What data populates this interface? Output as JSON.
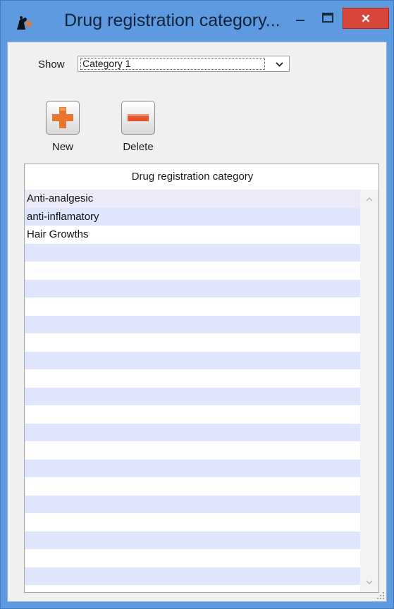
{
  "window": {
    "title": "Drug registration category..."
  },
  "filter": {
    "show_label": "Show",
    "selected": "Category 1"
  },
  "toolbar": {
    "new_label": "New",
    "delete_label": "Delete"
  },
  "grid": {
    "column_header": "Drug registration category",
    "rows": [
      "Anti-analgesic",
      "anti-inflamatory",
      "Hair Growths"
    ]
  },
  "colors": {
    "titlebar": "#5d9ae0",
    "close_button": "#d9463b",
    "row_alt": "#dfe5fc",
    "add_icon": "#e8742f",
    "delete_icon": "#e0532d"
  },
  "icons": {
    "app": "app-icon",
    "minimize": "minimize-icon",
    "maximize": "maximize-icon",
    "close": "close-icon",
    "dropdown": "chevron-down-icon",
    "add": "plus-icon",
    "delete": "minus-icon"
  }
}
